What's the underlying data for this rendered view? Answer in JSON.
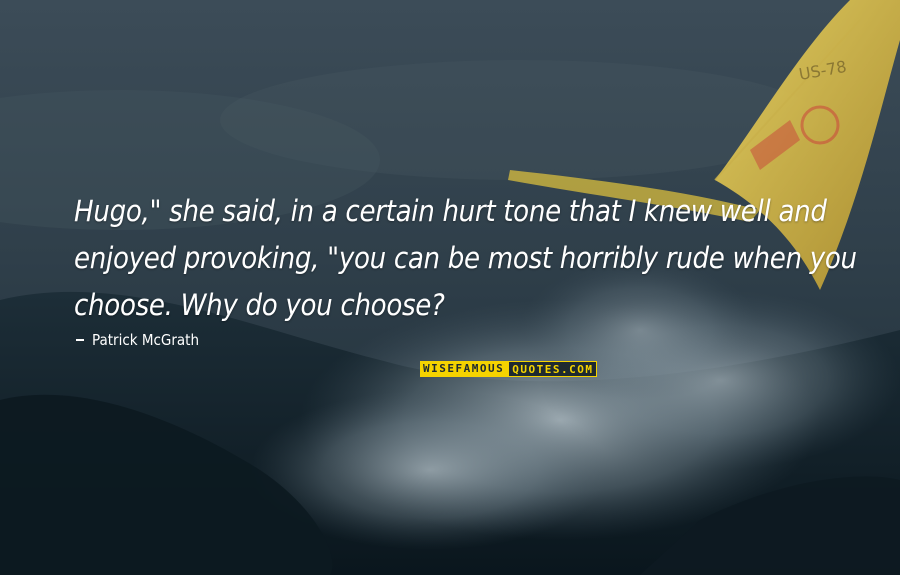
{
  "quote": {
    "text": "Hugo,\" she said, in a certain hurt tone that I knew well and enjoyed provoking, \"you can be most horribly rude when you choose. Why do you choose?",
    "author": "Patrick McGrath"
  },
  "watermark": {
    "part1": "WISEFAMOUS",
    "part2": "QUOTES.COM"
  },
  "colors": {
    "sky": "#33434e",
    "sea": "#0f1e27",
    "spray": "#9aa9b2",
    "sail": "#e6c94a",
    "brand_yellow": "#f5d300"
  }
}
